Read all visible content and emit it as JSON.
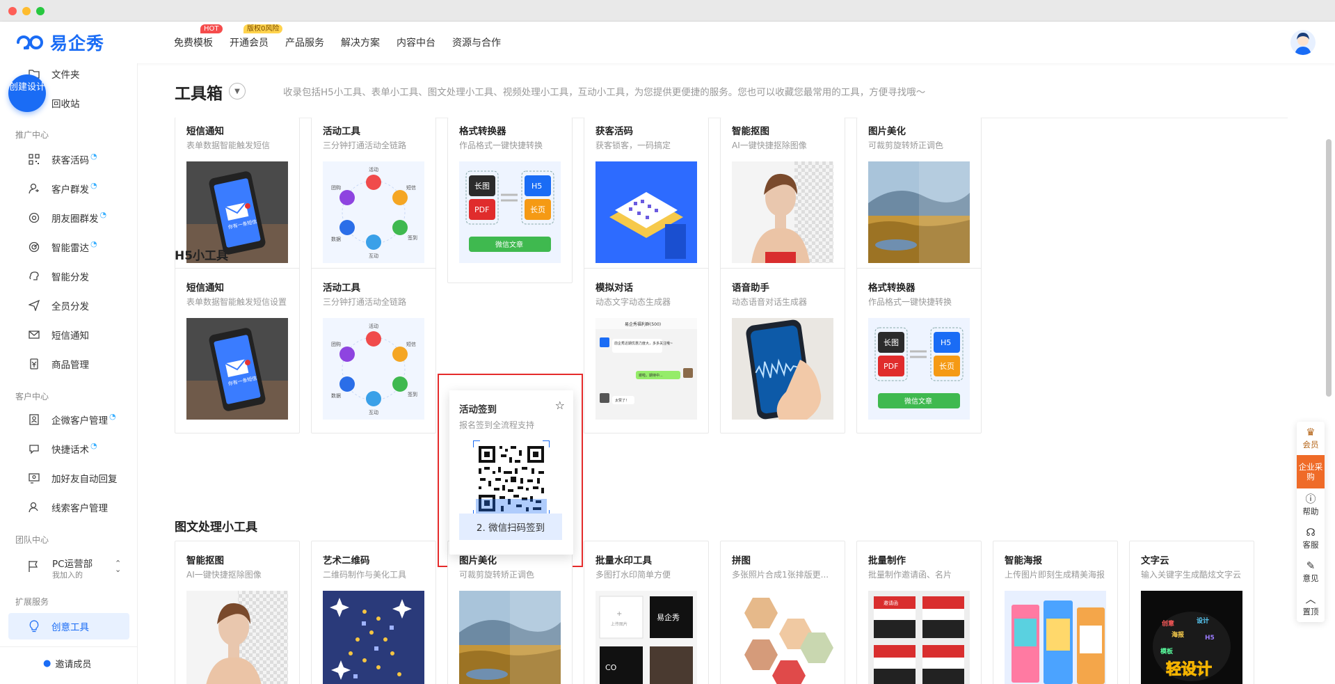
{
  "header": {
    "logo_text": "易企秀",
    "nav": [
      {
        "label": "免费模板",
        "badge": "HOT"
      },
      {
        "label": "开通会员",
        "badge": "版权0风险"
      },
      {
        "label": "产品服务"
      },
      {
        "label": "解决方案"
      },
      {
        "label": "内容中台"
      },
      {
        "label": "资源与合作"
      }
    ]
  },
  "sidebar": {
    "create_button": "创建设计",
    "top_items": [
      "文件夹",
      "回收站"
    ],
    "groups": {
      "promo": "推广中心",
      "customer": "客户中心",
      "team": "团队中心",
      "ext": "扩展服务"
    },
    "promo_items": [
      "获客活码",
      "客户群发",
      "朋友圈群发",
      "智能雷达",
      "智能分发",
      "全员分发",
      "短信通知",
      "商品管理"
    ],
    "customer_items": [
      "企微客户管理",
      "快捷话术",
      "加好友自动回复",
      "线索客户管理"
    ],
    "team_name": "PC运营部",
    "team_sub": "我加入的",
    "ext_item": "创意工具",
    "invite": "邀请成员"
  },
  "toolbox": {
    "title": "工具箱",
    "desc": "收录包括H5小工具、表单小工具、图文处理小工具、视频处理小工具，互动小工具，为您提供更便捷的服务。您也可以收藏您最常用的工具，方便寻找哦～"
  },
  "row1": [
    {
      "title": "短信通知",
      "desc": "表单数据智能触发短信"
    },
    {
      "title": "活动工具",
      "desc": "三分钟打通活动全链路"
    },
    {
      "title": "格式转换器",
      "desc": "作品格式一键快捷转换"
    },
    {
      "title": "获客活码",
      "desc": "获客锁客，一码搞定"
    },
    {
      "title": "智能抠图",
      "desc": "AI一键快捷抠除图像"
    },
    {
      "title": "图片美化",
      "desc": "可裁剪旋转矫正调色"
    }
  ],
  "h5_section": "H5小工具",
  "row2": [
    {
      "title": "短信通知",
      "desc": "表单数据智能触发短信设置"
    },
    {
      "title": "活动工具",
      "desc": "三分钟打通活动全链路"
    },
    {
      "title": "活动签到",
      "desc": "报名签到全流程支持",
      "button": "2. 微信扫码签到"
    },
    {
      "title": "模拟对话",
      "desc": "动态文字动态生成器"
    },
    {
      "title": "语音助手",
      "desc": "动态语音对话生成器"
    },
    {
      "title": "格式转换器",
      "desc": "作品格式一键快捷转换"
    }
  ],
  "image_section": "图文处理小工具",
  "row3": [
    {
      "title": "智能抠图",
      "desc": "AI一键快捷抠除图像"
    },
    {
      "title": "艺术二维码",
      "desc": "二维码制作与美化工具"
    },
    {
      "title": "图片美化",
      "desc": "可裁剪旋转矫正调色"
    },
    {
      "title": "批量水印工具",
      "desc": "多图打水印简单方便"
    },
    {
      "title": "拼图",
      "desc": "多张照片合成1张排版更..."
    },
    {
      "title": "批量制作",
      "desc": "批量制作邀请函、名片"
    },
    {
      "title": "智能海报",
      "desc": "上传图片即刻生成精美海报"
    },
    {
      "title": "文字云",
      "desc": "输入关键字生成酷炫文字云"
    }
  ],
  "thumb_text": {
    "sms_bubble": "你有一条短信",
    "act_nodes": [
      "活动",
      "短信",
      "签到",
      "互动",
      "数据",
      "团购"
    ],
    "convert_left": [
      "长图",
      "PDF"
    ],
    "convert_right": [
      "H5",
      "长页"
    ],
    "convert_bottom": "微信文章",
    "chat_title": "易企秀福利群(500)",
    "chat_msg1": "前企秀近期优惠力度大，多多关注哦~",
    "chat_msg2": "谢啦，期待中...",
    "chat_msg3": "太赞了！",
    "watermark_tag": "上传图片",
    "watermark_logo": "易企秀",
    "invite_label": "邀请函",
    "wordcloud_text": "轻设计"
  },
  "rightbar": [
    "会员",
    "企业采购",
    "帮助",
    "客服",
    "意见",
    "置顶"
  ],
  "colors": {
    "brand": "#1a6cf5",
    "highlight": "#e52b2b",
    "buy": "#ef6b28"
  }
}
